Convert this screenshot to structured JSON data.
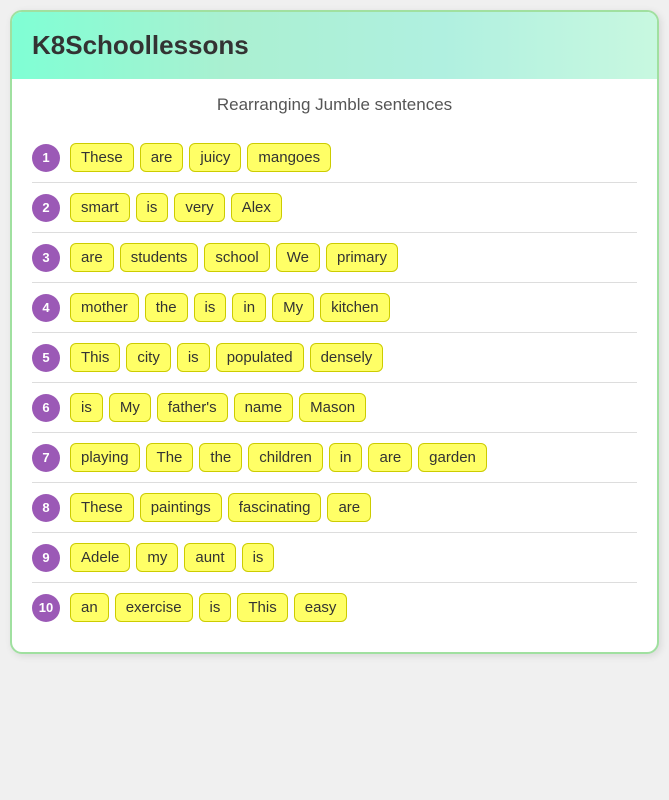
{
  "header": {
    "title": "K8Schoollessons"
  },
  "page": {
    "subtitle": "Rearranging Jumble sentences"
  },
  "sentences": [
    {
      "number": "1",
      "words": [
        "These",
        "are",
        "juicy",
        "mangoes"
      ]
    },
    {
      "number": "2",
      "words": [
        "smart",
        "is",
        "very",
        "Alex"
      ]
    },
    {
      "number": "3",
      "words": [
        "are",
        "students",
        "school",
        "We",
        "primary"
      ]
    },
    {
      "number": "4",
      "words": [
        "mother",
        "the",
        "is",
        "in",
        "My",
        "kitchen"
      ]
    },
    {
      "number": "5",
      "words": [
        "This",
        "city",
        "is",
        "populated",
        "densely"
      ]
    },
    {
      "number": "6",
      "words": [
        "is",
        "My",
        "father's",
        "name",
        "Mason"
      ]
    },
    {
      "number": "7",
      "words": [
        "playing",
        "The",
        "the",
        "children",
        "in",
        "are",
        "garden"
      ]
    },
    {
      "number": "8",
      "words": [
        "These",
        "paintings",
        "fascinating",
        "are"
      ]
    },
    {
      "number": "9",
      "words": [
        "Adele",
        "my",
        "aunt",
        "is"
      ]
    },
    {
      "number": "10",
      "words": [
        "an",
        "exercise",
        "is",
        "This",
        "easy"
      ]
    }
  ]
}
